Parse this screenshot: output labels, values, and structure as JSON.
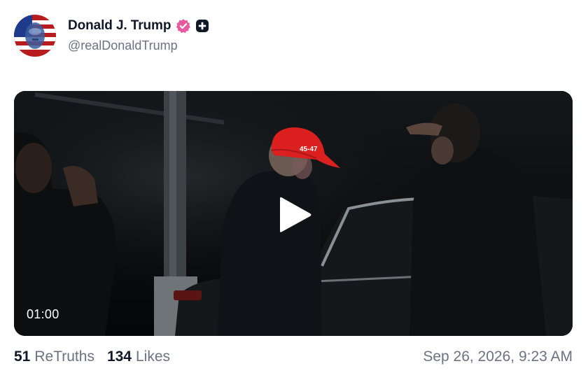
{
  "post": {
    "author": {
      "display_name": "Donald J. Trump",
      "handle": "@realDonaldTrump",
      "verified_badge_color": "#e85aa0",
      "badge_icons": [
        "verified-badge-icon",
        "plus-badge-icon"
      ]
    },
    "video": {
      "duration": "01:00",
      "cap_text": "45-47",
      "cap_color": "#dc1f1f"
    },
    "stats": {
      "retruths_count": "51",
      "retruths_label": "ReTruths",
      "likes_count": "134",
      "likes_label": "Likes"
    },
    "timestamp": "Sep 26, 2026, 9:23 AM"
  }
}
